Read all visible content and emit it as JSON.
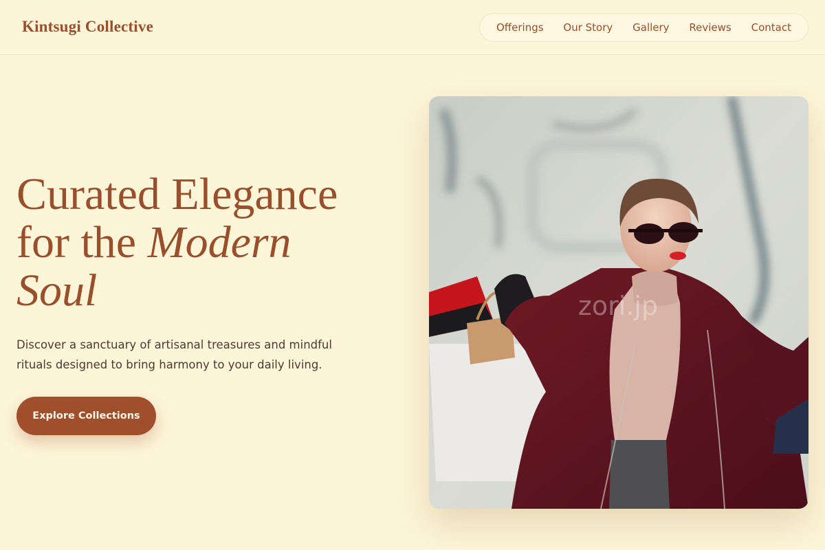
{
  "brand": {
    "name": "Kintsugi Collective"
  },
  "nav": {
    "items": [
      {
        "label": "Offerings"
      },
      {
        "label": "Our Story"
      },
      {
        "label": "Gallery"
      },
      {
        "label": "Reviews"
      },
      {
        "label": "Contact"
      }
    ]
  },
  "hero": {
    "title_line1": "Curated Elegance",
    "title_line2_plain": "for the ",
    "title_line2_em": "Modern",
    "title_line3_em": "Soul",
    "description": "Discover a sanctuary of artisanal treasures and mindful rituals designed to bring harmony to your daily living.",
    "cta_label": "Explore Collections"
  },
  "hero_image": {
    "watermark": "zori.jp",
    "subject": "woman in sunglasses and burgundy coat carrying shopping bags"
  },
  "colors": {
    "background": "#fdf5d8",
    "brand": "#9a4f2c",
    "button": "#a04f2d",
    "body_text": "#4a3a32"
  }
}
